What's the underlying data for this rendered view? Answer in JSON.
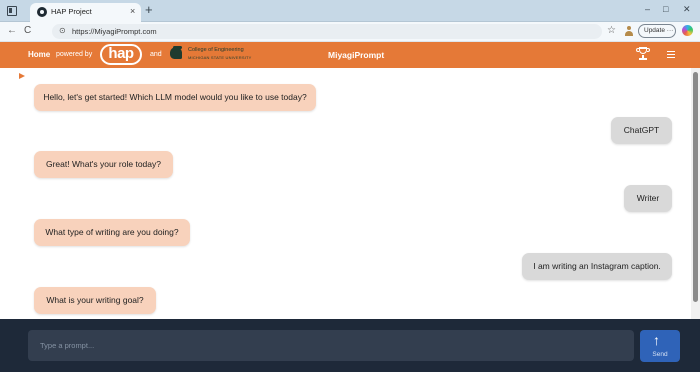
{
  "browser": {
    "tab_title": "HAP Project",
    "tab_close": "×",
    "new_tab": "+",
    "window_controls": {
      "minimize": "–",
      "maximize": "□",
      "close": "✕"
    },
    "url": "https://MiyagiPrompt.com",
    "update_label": "Update",
    "update_more": "···"
  },
  "header": {
    "home_label": "Home",
    "powered_by": "powered by",
    "hap_logo_text": "hap",
    "and_label": "and",
    "college_line1": "College of Engineering",
    "college_line2": "MICHIGAN STATE UNIVERSITY",
    "app_title": "MiyagiPrompt",
    "accent_color": "#e57937"
  },
  "chat": {
    "messages": [
      {
        "role": "bot",
        "text": "Hello, let's get started! Which LLM model would you like to use today?"
      },
      {
        "role": "user",
        "text": "ChatGPT"
      },
      {
        "role": "bot",
        "text": "Great! What's your role today?"
      },
      {
        "role": "user",
        "text": "Writer"
      },
      {
        "role": "bot",
        "text": "What type of writing are you doing?"
      },
      {
        "role": "user",
        "text": "I am writing an Instagram caption."
      },
      {
        "role": "bot",
        "text": "What is your writing goal?"
      }
    ],
    "bot_bubble_color": "#f8d2bc",
    "user_bubble_color": "#d9d9d9"
  },
  "input": {
    "placeholder": "Type a prompt...",
    "value": "",
    "send_label": "Send",
    "send_icon": "↑"
  },
  "icons": {
    "back": "←",
    "refresh": "C",
    "lock": "⊙",
    "star": "☆"
  }
}
